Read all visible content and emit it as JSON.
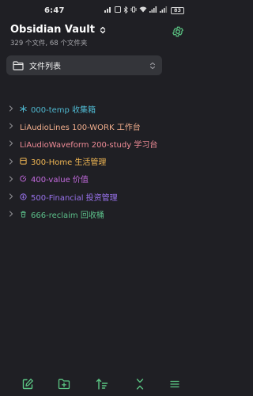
{
  "status_bar": {
    "time": "6:47",
    "battery": "83"
  },
  "vault": {
    "name": "Obsidian Vault",
    "stats": "329 个文件, 68 个文件夹"
  },
  "selector": {
    "label": "文件列表"
  },
  "tree": {
    "items": [
      {
        "label": "000-temp 收集箱",
        "color": "#4fb8d0",
        "icon": "snowflake-icon"
      },
      {
        "label": "LiAudioLines 100-WORK 工作台",
        "color": "#f0ad8c",
        "icon": ""
      },
      {
        "label": "LiAudioWaveform 200-study 学习台",
        "color": "#f08c97",
        "icon": ""
      },
      {
        "label": "300-Home 生活管理",
        "color": "#f0b653",
        "icon": "home-icon"
      },
      {
        "label": "400-value 价值",
        "color": "#c56be0",
        "icon": "value-icon"
      },
      {
        "label": "500-Financial 投资管理",
        "color": "#9a73ee",
        "icon": "coin-icon"
      },
      {
        "label": "666-reclaim 回收桶",
        "color": "#5cc08a",
        "icon": "trash-icon"
      }
    ]
  },
  "toolbar": {
    "icons": [
      "new-note-icon",
      "new-folder-icon",
      "sort-icon",
      "collapse-all-icon",
      "menu-icon"
    ]
  },
  "colors": {
    "accent": "#5bc684",
    "background": "#1f1f24",
    "selector_bg": "#34353a"
  }
}
